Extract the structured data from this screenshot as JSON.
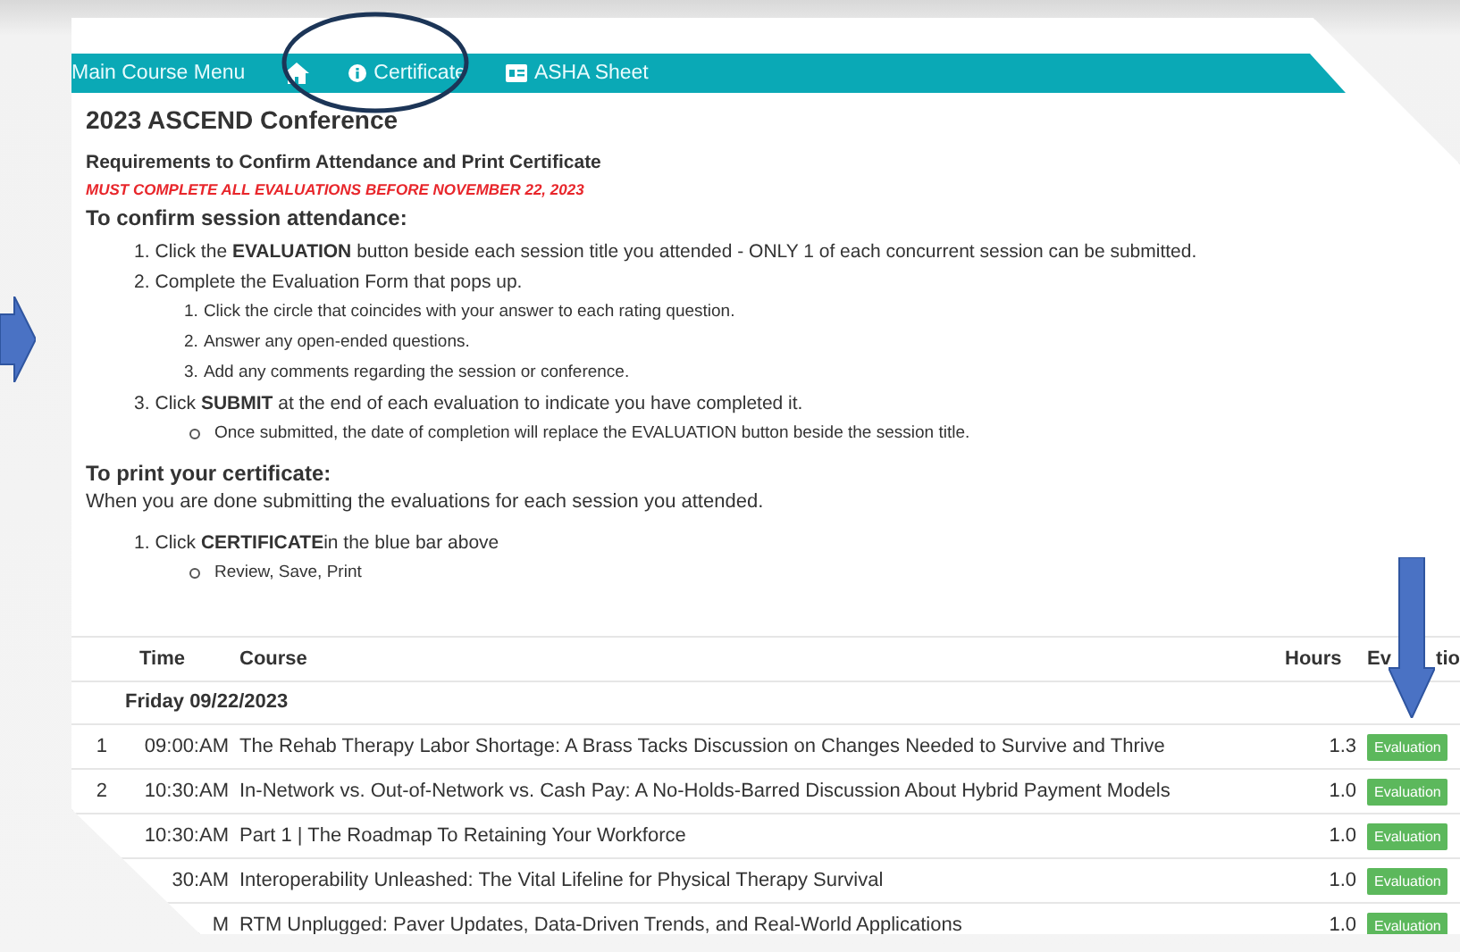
{
  "nav": [
    {
      "kind": "text",
      "label": "Main Course Menu"
    },
    {
      "kind": "home"
    },
    {
      "kind": "info",
      "label": "Certificate"
    },
    {
      "kind": "sheet",
      "label": "ASHA Sheet"
    }
  ],
  "page": {
    "title": "2023 ASCEND Conference",
    "requirements": "Requirements to Confirm Attendance and Print Certificate",
    "deadline": "MUST COMPLETE ALL EVALUATIONS BEFORE NOVEMBER 22, 2023",
    "confirm_heading": "To confirm session attendance:",
    "confirm_steps": [
      {
        "marker": "1.",
        "text": "Click the **EVALUATION** button beside each session title you attended - ONLY 1 of each concurrent session can be submitted."
      },
      {
        "marker": "2.",
        "text": "Complete the Evaluation Form that pops up.",
        "substeps": [
          {
            "marker": "1.",
            "text": "Click the circle that coincides with your answer to each rating question."
          },
          {
            "marker": "2.",
            "text": "Answer any open-ended questions."
          },
          {
            "marker": "3.",
            "text": "Add any comments regarding the session or conference."
          }
        ]
      },
      {
        "marker": "3.",
        "text": "Click **SUBMIT** at the end of each evaluation to indicate you have completed it.",
        "notes": [
          "Once submitted, the date of completion will replace the EVALUATION button beside the session title."
        ]
      }
    ],
    "print_heading": "To print your certificate:",
    "print_intro": "When you are done submitting the evaluations for each session you attended.",
    "print_steps": [
      {
        "marker": "1.",
        "text": "Click **CERTIFICATE**in the blue bar above",
        "notes": [
          "Review, Save, Print"
        ]
      }
    ]
  },
  "table": {
    "columns": [
      "Time",
      "Course",
      "Hours"
    ],
    "evaluation_header_parts": [
      "Ev",
      "tio"
    ],
    "group": "Friday 09/22/2023",
    "rows": [
      {
        "num": "1",
        "time": "09:00:AM",
        "course": "The Rehab Therapy Labor Shortage: A Brass Tacks Discussion on Changes Needed to Survive and Thrive",
        "hours": "1.3",
        "action": "Evaluation"
      },
      {
        "num": "2",
        "time": "10:30:AM",
        "course": "In-Network vs. Out-of-Network vs. Cash Pay: A No-Holds-Barred Discussion About Hybrid Payment Models",
        "hours": "1.0",
        "action": "Evaluation"
      },
      {
        "time": "10:30:AM",
        "course": "Part 1 | The Roadmap To Retaining Your Workforce",
        "hours": "1.0",
        "action": "Evaluation"
      },
      {
        "time": "30:AM",
        "course": "Interoperability Unleashed: The Vital Lifeline for Physical Therapy Survival",
        "hours": "1.0",
        "action": "Evaluation"
      },
      {
        "time": "M",
        "course": "RTM Unplugged: Paver Updates, Data-Driven Trends, and Real-World Applications",
        "hours": "1.0",
        "action": "Evaluation"
      }
    ]
  }
}
